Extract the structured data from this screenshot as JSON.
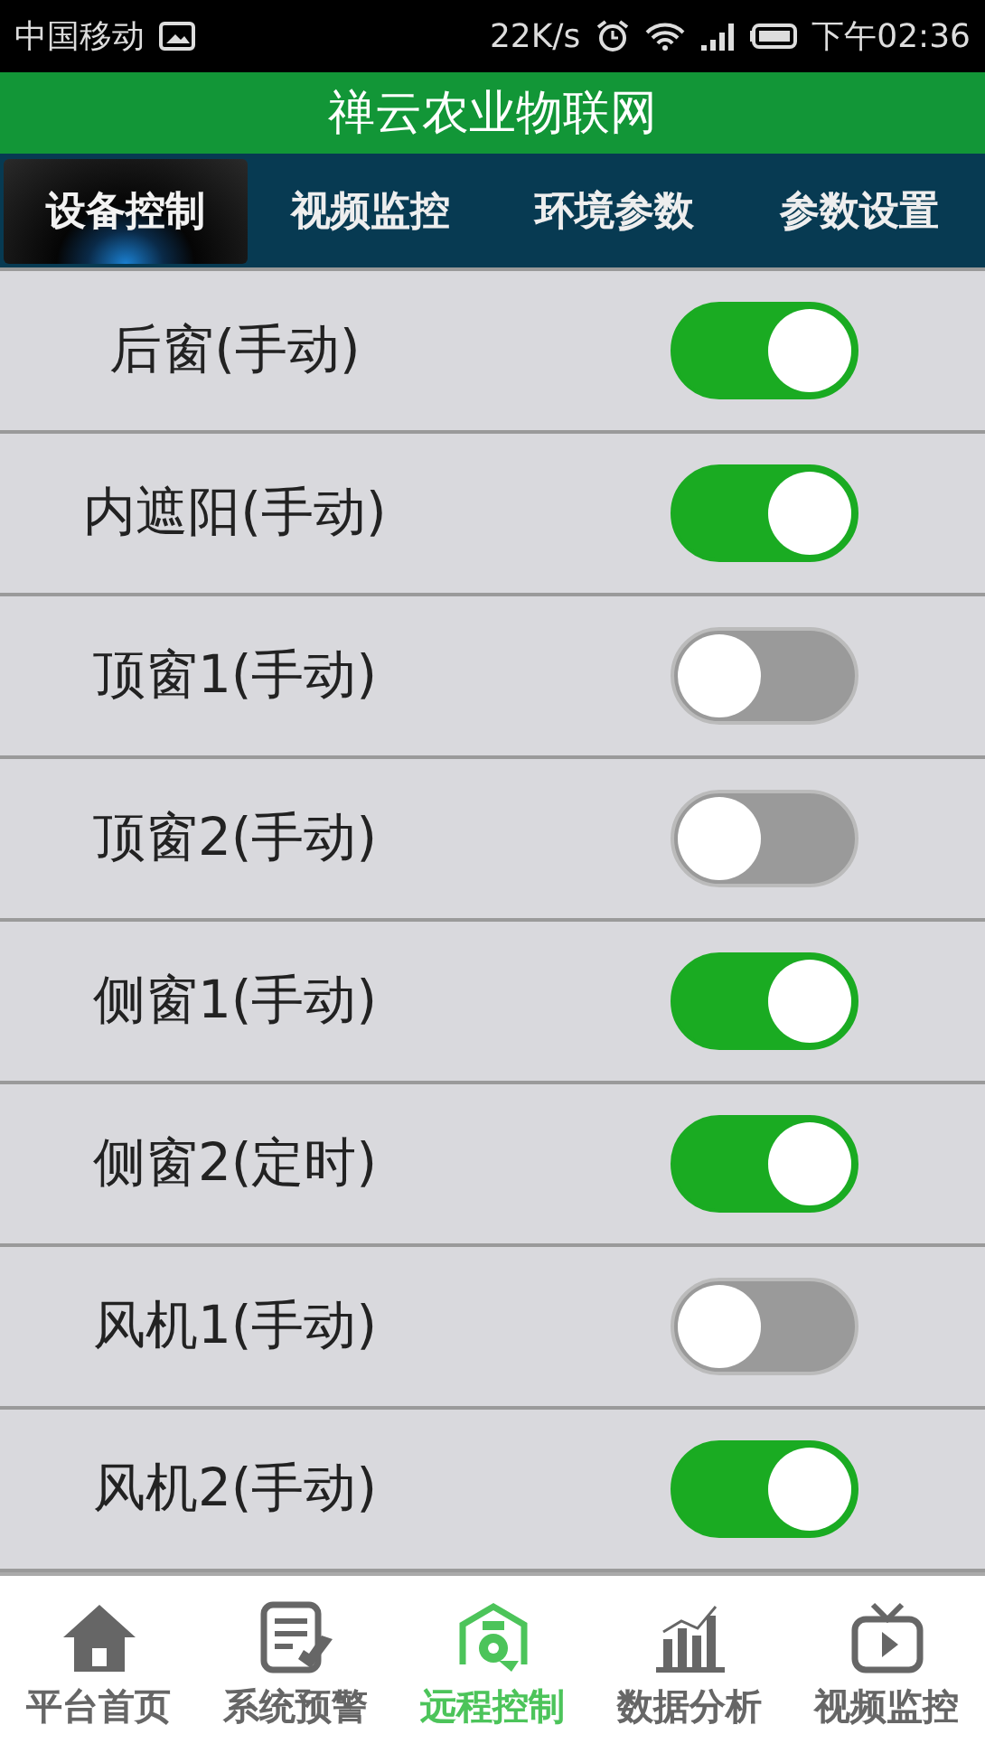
{
  "status_bar": {
    "carrier": "中国移动",
    "speed": "22K/s",
    "time": "下午02:36"
  },
  "header": {
    "title": "禅云农业物联网"
  },
  "tabs": [
    {
      "label": "设备控制",
      "selected": true
    },
    {
      "label": "视频监控",
      "selected": false
    },
    {
      "label": "环境参数",
      "selected": false
    },
    {
      "label": "参数设置",
      "selected": false
    }
  ],
  "devices": [
    {
      "name": "后窗(手动)",
      "on": true
    },
    {
      "name": "内遮阳(手动)",
      "on": true
    },
    {
      "name": "顶窗1(手动)",
      "on": false
    },
    {
      "name": "顶窗2(手动)",
      "on": false
    },
    {
      "name": "侧窗1(手动)",
      "on": true
    },
    {
      "name": "侧窗2(定时)",
      "on": true
    },
    {
      "name": "风机1(手动)",
      "on": false
    },
    {
      "name": "风机2(手动)",
      "on": true
    }
  ],
  "bottom_nav": [
    {
      "label": "平台首页",
      "kind": "home",
      "selected": false
    },
    {
      "label": "系统预警",
      "kind": "alert",
      "selected": false
    },
    {
      "label": "远程控制",
      "kind": "control",
      "selected": true
    },
    {
      "label": "数据分析",
      "kind": "chart",
      "selected": false
    },
    {
      "label": "视频监控",
      "kind": "video",
      "selected": false
    }
  ]
}
